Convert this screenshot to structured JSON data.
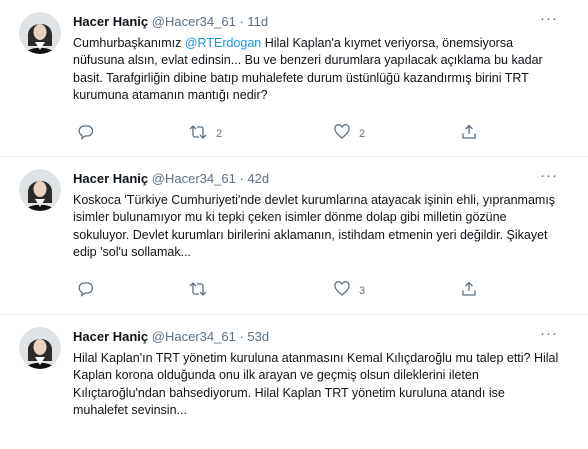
{
  "tweets": [
    {
      "name": "Hacer Haniç",
      "handle": "@Hacer34_61",
      "dot": "·",
      "time": "11d",
      "text_pre": "Cumhurbaşkanımız ",
      "mention": "@RTErdogan",
      "text_post": " Hilal Kaplan'a kıymet veriyorsa, önemsiyorsa nüfusuna alsın, evlat edinsin... Bu ve benzeri durumlara yapılacak açıklama bu kadar basit. Tarafgirliğin dibine batıp muhalefete durum üstünlüğü kazandırmış birini TRT kurumuna atamanın mantığı nedir?",
      "retweets": "2",
      "likes": "2"
    },
    {
      "name": "Hacer Haniç",
      "handle": "@Hacer34_61",
      "dot": "·",
      "time": "42d",
      "text": "Koskoca 'Türkiye Cumhuriyeti'nde devlet kurumlarına atayacak işinin ehli, yıpranmamış isimler bulunamıyor mu ki tepki çeken isimler dönme dolap gibi milletin gözüne sokuluyor. Devlet kurumları birilerini aklamanın, istihdam etmenin yeri değildir. Şikayet edip 'sol'u sollamak...",
      "likes": "3"
    },
    {
      "name": "Hacer Haniç",
      "handle": "@Hacer34_61",
      "dot": "·",
      "time": "53d",
      "text": "Hilal Kaplan'ın TRT yönetim kuruluna atanmasını Kemal Kılıçdaroğlu mu talep etti? Hilal Kaplan korona olduğunda onu ilk arayan ve geçmiş olsun dileklerini ileten Kılıçtaroğlu'ndan bahsediyorum. Hilal Kaplan TRT yönetim kuruluna atandı ise muhalefet sevinsin..."
    }
  ],
  "more_glyph": "···",
  "colors": {
    "link": "#1b95e0",
    "muted": "#5b7083",
    "divider": "#e6ecf0"
  },
  "icons": [
    "reply-icon",
    "retweet-icon",
    "like-icon",
    "share-icon",
    "more-icon"
  ]
}
